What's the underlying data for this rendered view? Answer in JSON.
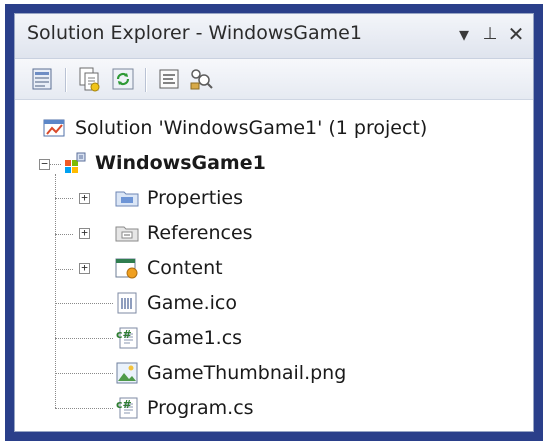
{
  "window": {
    "title": "Solution Explorer - WindowsGame1",
    "buttons": {
      "dropdown": "▾",
      "pin": "⊥",
      "close": "✕"
    }
  },
  "toolbar": {
    "items": [
      {
        "name": "properties-icon"
      },
      {
        "name": "show-all-files-icon"
      },
      {
        "name": "refresh-icon"
      },
      {
        "name": "view-code-icon"
      },
      {
        "name": "class-diagram-icon"
      }
    ]
  },
  "tree": {
    "solution": {
      "label": "Solution 'WindowsGame1' (1 project)",
      "icon": "solution-icon"
    },
    "project": {
      "label": "WindowsGame1",
      "icon": "project-icon",
      "expander": "−"
    },
    "items": [
      {
        "label": "Properties",
        "icon": "properties-folder-icon",
        "expander": "+"
      },
      {
        "label": "References",
        "icon": "references-folder-icon",
        "expander": "+"
      },
      {
        "label": "Content",
        "icon": "content-project-icon",
        "expander": "+"
      },
      {
        "label": "Game.ico",
        "icon": "ico-file-icon"
      },
      {
        "label": "Game1.cs",
        "icon": "csharp-file-icon"
      },
      {
        "label": "GameThumbnail.png",
        "icon": "png-file-icon"
      },
      {
        "label": "Program.cs",
        "icon": "csharp-file-icon"
      }
    ]
  },
  "colors": {
    "frame": "#2a3f8a",
    "titlebar": "#dfe4ee",
    "accent": "#2f6fc0"
  }
}
